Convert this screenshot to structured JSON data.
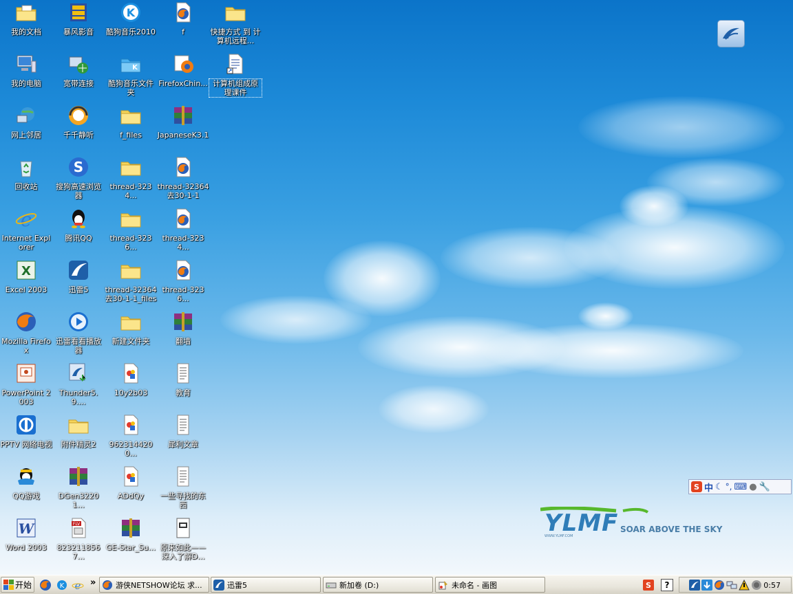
{
  "desktop": {
    "icons": [
      {
        "label": "我的文档",
        "icon": "my-documents-icon",
        "interactable": true
      },
      {
        "label": "暴风影音",
        "icon": "media-player-icon",
        "interactable": true
      },
      {
        "label": "酷狗音乐2010",
        "icon": "kugou-icon",
        "interactable": true
      },
      {
        "label": "f",
        "icon": "firefox-html-icon",
        "interactable": true
      },
      {
        "label": "快捷方式 到 计算机远程...",
        "icon": "folder-shortcut-icon",
        "interactable": true
      },
      {
        "label": "我的电脑",
        "icon": "my-computer-icon",
        "interactable": true
      },
      {
        "label": "宽带连接",
        "icon": "broadband-icon",
        "interactable": true
      },
      {
        "label": "酷狗音乐文件夹",
        "icon": "kugou-folder-icon",
        "interactable": true
      },
      {
        "label": "FirefoxChin...",
        "icon": "installer-icon",
        "interactable": true
      },
      {
        "label": "计算机组成原理课件",
        "icon": "document-shortcut-icon",
        "interactable": true
      },
      {
        "label": "网上邻居",
        "icon": "network-icon",
        "interactable": true
      },
      {
        "label": "千千静听",
        "icon": "ttplayer-icon",
        "interactable": true
      },
      {
        "label": "f_files",
        "icon": "folder-icon",
        "interactable": true
      },
      {
        "label": "JapaneseK3.1",
        "icon": "winrar-icon",
        "interactable": true
      },
      {
        "label": "回收站",
        "icon": "recycle-bin-icon",
        "interactable": true
      },
      {
        "label": "搜狗高速浏览器",
        "icon": "sogou-browser-icon",
        "interactable": true
      },
      {
        "label": "thread-3234...",
        "icon": "folder-icon",
        "interactable": true
      },
      {
        "label": "thread-32364 去30-1-1",
        "icon": "firefox-html-icon",
        "interactable": true
      },
      {
        "label": "Internet Explorer",
        "icon": "ie-icon",
        "interactable": true
      },
      {
        "label": "腾讯QQ",
        "icon": "qq-icon",
        "interactable": true
      },
      {
        "label": "thread-3236...",
        "icon": "folder-icon",
        "interactable": true
      },
      {
        "label": "thread-3234...",
        "icon": "firefox-html-icon",
        "interactable": true
      },
      {
        "label": "Excel 2003",
        "icon": "excel-icon",
        "interactable": true
      },
      {
        "label": "迅雷5",
        "icon": "thunder-icon",
        "interactable": true
      },
      {
        "label": "thread-32364 去30-1-1_files",
        "icon": "folder-icon",
        "interactable": true
      },
      {
        "label": "thread-3236...",
        "icon": "firefox-html-icon",
        "interactable": true
      },
      {
        "label": "Mozilla Firefox",
        "icon": "firefox-icon",
        "interactable": true
      },
      {
        "label": "迅雷看看播放器",
        "icon": "xunlei-player-icon",
        "interactable": true
      },
      {
        "label": "新建文件夹",
        "icon": "folder-icon",
        "interactable": true
      },
      {
        "label": "翻墙",
        "icon": "winrar-icon",
        "interactable": true
      },
      {
        "label": "PowerPoint 2003",
        "icon": "powerpoint-icon",
        "interactable": true
      },
      {
        "label": "Thunder5.9....",
        "icon": "thunder-installer-icon",
        "interactable": true
      },
      {
        "label": "10y2b03",
        "icon": "image-file-icon",
        "interactable": true
      },
      {
        "label": "教育",
        "icon": "text-file-icon",
        "interactable": true
      },
      {
        "label": "PPTV 网络电视",
        "icon": "pptv-icon",
        "interactable": true
      },
      {
        "label": "附件精灵2",
        "icon": "folder-icon",
        "interactable": true
      },
      {
        "label": "9623144200...",
        "icon": "image-file-icon",
        "interactable": true
      },
      {
        "label": "犀利文章",
        "icon": "text-file-icon",
        "interactable": true
      },
      {
        "label": "QQ游戏",
        "icon": "qq-game-icon",
        "interactable": true
      },
      {
        "label": "DGen32201...",
        "icon": "winrar-icon",
        "interactable": true
      },
      {
        "label": "ADdQy",
        "icon": "image-file-icon",
        "interactable": true
      },
      {
        "label": "一些寻找的东西",
        "icon": "text-file-icon",
        "interactable": true
      },
      {
        "label": "Word 2003",
        "icon": "word-icon",
        "interactable": true
      },
      {
        "label": "8232118567...",
        "icon": "flv-file-icon",
        "interactable": true
      },
      {
        "label": "GE-Star_Su...",
        "icon": "winrar-icon",
        "interactable": true
      },
      {
        "label": "原来如此——深入了解D...",
        "icon": "image-doc-icon",
        "interactable": true
      }
    ],
    "wallpaper_logo": {
      "brand": "YLMF",
      "tagline": "SOAR ABOVE THE SKY",
      "url": "WWW.YLMF.COM"
    },
    "thunder_float_icon": "thunder-float-icon",
    "ime_bar": {
      "mode": "中",
      "icons": [
        "sogou-s-icon",
        "ime-mode-icon",
        "moon-icon",
        "punctuation-icon",
        "keyboard-icon",
        "user-icon",
        "wrench-icon"
      ]
    }
  },
  "taskbar": {
    "start_label": "开始",
    "quick_launch": [
      "firefox-icon",
      "kugou-icon",
      "ie-icon"
    ],
    "chevron": "»",
    "tasks": [
      {
        "label": "游侠NETSHOW论坛 求...",
        "icon": "firefox-icon",
        "active": false
      },
      {
        "label": "迅雷5",
        "icon": "thunder-icon",
        "active": false
      },
      {
        "label": "新加卷 (D:)",
        "icon": "drive-icon",
        "active": false
      },
      {
        "label": "未命名 - 画图",
        "icon": "paint-icon",
        "active": false
      }
    ],
    "tray_left": [
      "sogou-tray-icon",
      "help-icon"
    ],
    "tray_icons": [
      "thunder-tray-icon",
      "download-tray-icon",
      "firefox-tray-icon",
      "network-tray-icon",
      "warning-tray-icon",
      "sound-tray-icon"
    ],
    "clock": "0:57"
  },
  "colors": {
    "accent": "#0b74c9",
    "taskbar": "#e9e6dc"
  }
}
